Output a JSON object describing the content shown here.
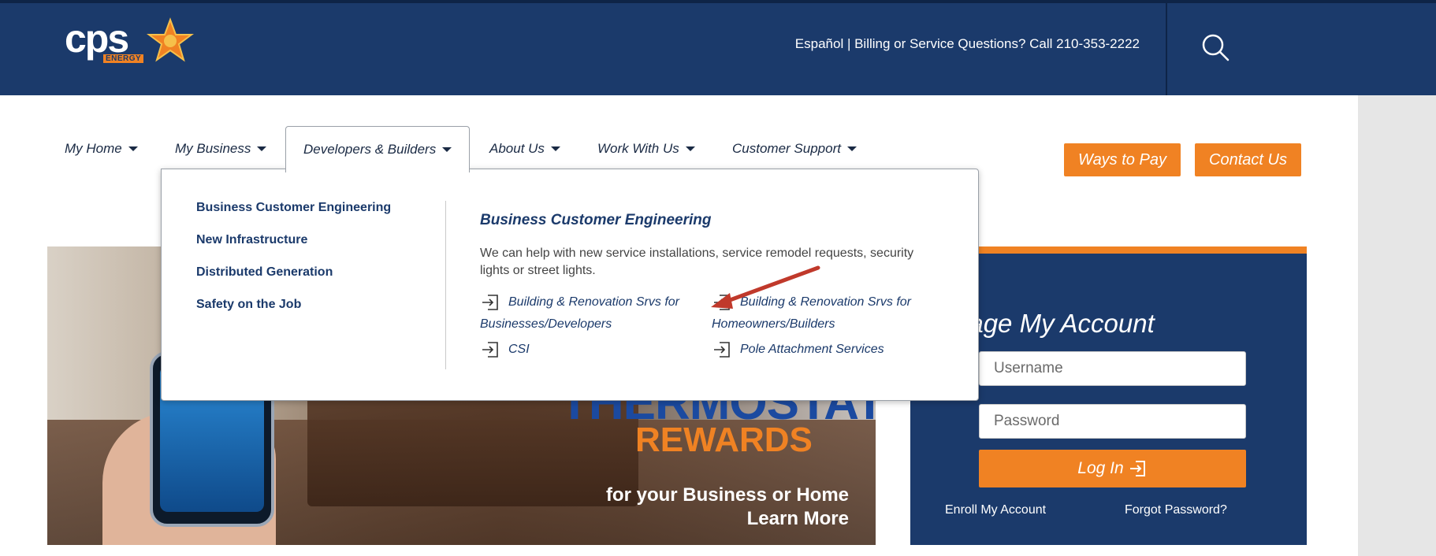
{
  "header": {
    "logo_text": "cps",
    "logo_sub": "ENERGY",
    "top_links": "Español |  Billing or Service Questions? Call 210-353-2222"
  },
  "icons": {
    "search": "search-icon",
    "logo_star": "star-icon",
    "link_arrow": "enter-arrow-icon",
    "login_arrow": "enter-arrow-icon",
    "annotation": "red-arrow-icon"
  },
  "nav": {
    "items": [
      {
        "label": "My Home"
      },
      {
        "label": "My Business"
      },
      {
        "label": "Developers & Builders"
      },
      {
        "label": "About Us"
      },
      {
        "label": "Work With Us"
      },
      {
        "label": "Customer Support"
      }
    ]
  },
  "buttons": {
    "ways_to_pay": "Ways to Pay",
    "contact_us": "Contact Us"
  },
  "dropdown": {
    "left_items": [
      {
        "label": "Business Customer Engineering"
      },
      {
        "label": "New Infrastructure"
      },
      {
        "label": "Distributed Generation"
      },
      {
        "label": "Safety on the Job"
      }
    ],
    "heading": "Business Customer Engineering",
    "description": "We can help with new service installations, service remodel requests, security lights or street lights.",
    "links": [
      {
        "label": "Building & Renovation Srvs for Businesses/Developers"
      },
      {
        "label": "Building & Renovation Srvs for Homeowners/Builders"
      },
      {
        "label": "CSI"
      },
      {
        "label": "Pole Attachment Services"
      }
    ]
  },
  "hero": {
    "title": "THERMOSTAT",
    "subtitle": "REWARDS",
    "caption_line1": "for your Business or Home",
    "caption_line2": "Learn More"
  },
  "account": {
    "title": "nage My Account",
    "username_placeholder": "Username",
    "password_placeholder": "Password",
    "login_label": "Log In",
    "enroll_label": "Enroll My Account",
    "forgot_label": "Forgot Password?"
  },
  "colors": {
    "navy": "#1b3a6b",
    "orange": "#f08223",
    "annotation_red": "#c0392b"
  }
}
